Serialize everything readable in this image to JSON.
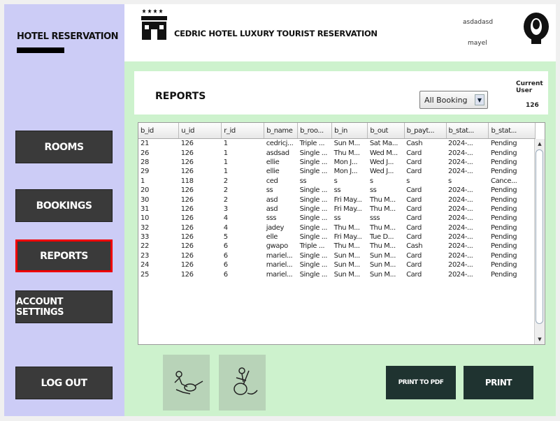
{
  "sidebar": {
    "brand": "HOTEL RESERVATION",
    "items": [
      {
        "label": "ROOMS"
      },
      {
        "label": "BOOKINGS"
      },
      {
        "label": "REPORTS"
      },
      {
        "label": "ACCOUNT SETTINGS"
      },
      {
        "label": "LOG OUT"
      }
    ],
    "active_item": "REPORTS"
  },
  "header": {
    "title": "CEDRIC HOTEL LUXURY TOURIST RESERVATION",
    "username_line1": "asdadasd",
    "username_line2": "mayel"
  },
  "reports": {
    "title": "REPORTS",
    "filter_selected": "All Booking",
    "current_user_label": "Current User",
    "current_user_value": "126"
  },
  "table": {
    "columns": [
      "b_id",
      "u_id",
      "r_id",
      "b_name",
      "b_roo...",
      "b_in",
      "b_out",
      "b_payt...",
      "b_stat...",
      "b_stat..."
    ],
    "rows": [
      [
        "21",
        "126",
        "1",
        "cedricj...",
        "Triple ...",
        "Sun M...",
        "Sat Ma...",
        "Cash",
        "2024-...",
        "Pending"
      ],
      [
        "26",
        "126",
        "1",
        "asdsad",
        "Single ...",
        "Thu M...",
        "Wed M...",
        "Card",
        "2024-...",
        "Pending"
      ],
      [
        "28",
        "126",
        "1",
        "ellie",
        "Single ...",
        "Mon J...",
        "Wed J...",
        "Card",
        "2024-...",
        "Pending"
      ],
      [
        "29",
        "126",
        "1",
        "ellie",
        "Single ...",
        "Mon J...",
        "Wed J...",
        "Card",
        "2024-...",
        "Pending"
      ],
      [
        "1",
        "118",
        "2",
        "ced",
        "ss",
        "s",
        "s",
        "s",
        "s",
        "Cance..."
      ],
      [
        "20",
        "126",
        "2",
        "ss",
        "Single ...",
        "ss",
        "ss",
        "Card",
        "2024-...",
        "Pending"
      ],
      [
        "30",
        "126",
        "2",
        "asd",
        "Single ...",
        "Fri May...",
        "Thu M...",
        "Card",
        "2024-...",
        "Pending"
      ],
      [
        "31",
        "126",
        "3",
        "asd",
        "Single ...",
        "Fri May...",
        "Thu M...",
        "Card",
        "2024-...",
        "Pending"
      ],
      [
        "10",
        "126",
        "4",
        "sss",
        "Single ...",
        "ss",
        "sss",
        "Card",
        "2024-...",
        "Pending"
      ],
      [
        "32",
        "126",
        "4",
        "jadey",
        "Single ...",
        "Thu M...",
        "Thu M...",
        "Card",
        "2024-...",
        "Pending"
      ],
      [
        "33",
        "126",
        "5",
        "elle",
        "Single ...",
        "Fri May...",
        "Tue D...",
        "Card",
        "2024-...",
        "Pending"
      ],
      [
        "22",
        "126",
        "6",
        "gwapo",
        "Triple ...",
        "Thu M...",
        "Thu M...",
        "Cash",
        "2024-...",
        "Pending"
      ],
      [
        "23",
        "126",
        "6",
        "mariel...",
        "Single ...",
        "Sun M...",
        "Sun M...",
        "Card",
        "2024-...",
        "Pending"
      ],
      [
        "24",
        "126",
        "6",
        "mariel...",
        "Single ...",
        "Sun M...",
        "Sun M...",
        "Card",
        "2024-...",
        "Pending"
      ],
      [
        "25",
        "126",
        "6",
        "mariel...",
        "Single ...",
        "Sun M...",
        "Sun M...",
        "Card",
        "2024-...",
        "Pending"
      ]
    ]
  },
  "actions": {
    "print_pdf": "PRINT TO PDF",
    "print": "PRINT"
  },
  "colors": {
    "sidebar_bg": "#ccccf6",
    "main_bg": "#cdf2cd",
    "nav_button": "#3a3a3a",
    "active_border": "#e00000",
    "action_button": "#1f3330"
  },
  "icons": {
    "hotel": "hotel-building-icon",
    "avatar": "user-avatar-icon",
    "guitar1": "guitar-player-icon",
    "guitar2": "guitar-music-icon"
  }
}
